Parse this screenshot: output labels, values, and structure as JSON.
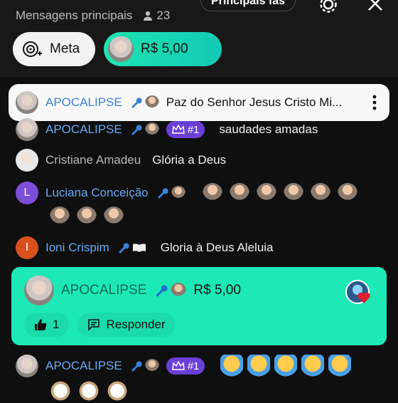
{
  "header": {
    "subtitle": "Mensagens principais",
    "viewer_count": "23",
    "top_fans_label": "Principais fãs"
  },
  "pills": {
    "meta_label": "Meta",
    "donation_amount": "R$ 5,00"
  },
  "pinned": {
    "name": "APOCALIPSE",
    "text": "Paz do Senhor Jesus Cristo Mi..."
  },
  "messages": [
    {
      "name": "APOCALIPSE",
      "badge": "#1",
      "text": "saudades amadas"
    },
    {
      "name": "Cristiane Amadeu",
      "text": "Glória a Deus"
    },
    {
      "name": "Luciana Conceição",
      "initial": "L"
    },
    {
      "name": "Ioni Crispim",
      "initial": "I",
      "text": "Gloria à Deus Aleluia"
    },
    {
      "name": "APOCALIPSE",
      "badge": "#1"
    }
  ],
  "superchat": {
    "name": "APOCALIPSE",
    "amount": "R$ 5,00",
    "like_count": "1",
    "reply_label": "Responder"
  },
  "colors": {
    "accent_teal": "#1de9b6",
    "member_badge": "#6b3fd6",
    "name_blue": "#6aa8f2"
  }
}
